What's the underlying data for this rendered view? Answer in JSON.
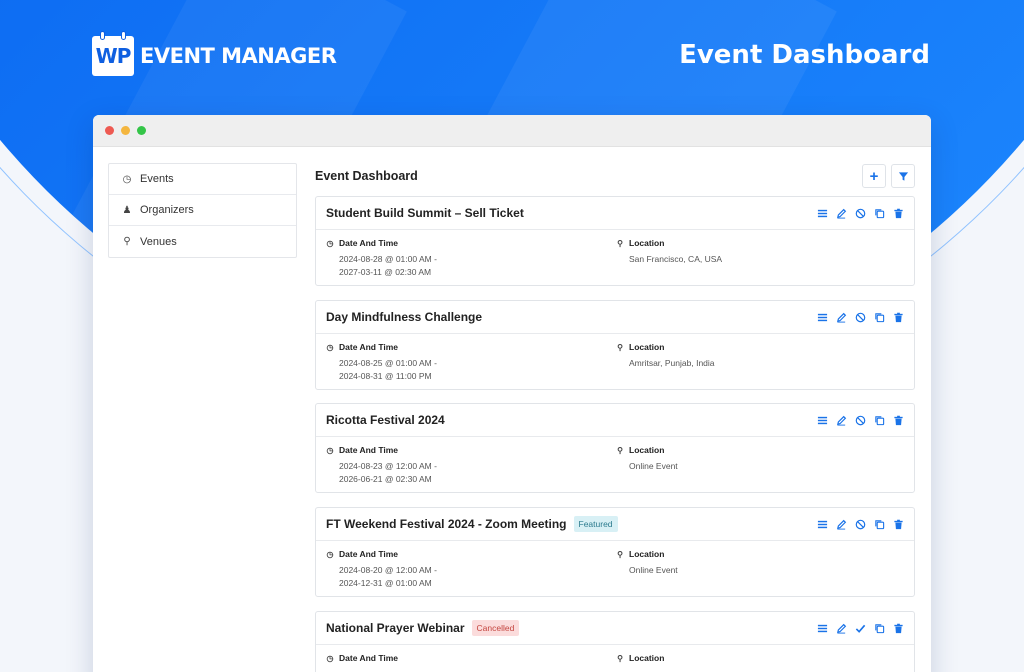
{
  "brand": {
    "mark": "WP",
    "name": "EVENT MANAGER"
  },
  "hero_title": "Event Dashboard",
  "sidebar": {
    "items": [
      {
        "label": "Events",
        "icon": "dashboard-icon"
      },
      {
        "label": "Organizers",
        "icon": "user-icon"
      },
      {
        "label": "Venues",
        "icon": "map-pin-icon"
      }
    ]
  },
  "main": {
    "title": "Event Dashboard",
    "buttons": {
      "add": "+",
      "filter": "filter-icon"
    }
  },
  "events": [
    {
      "title": "Student Build Summit – Sell Ticket",
      "badge": "",
      "date_label": "Date And Time",
      "date_start": "2024-08-28 @ 01:00 AM -",
      "date_end": "2027-03-11 @ 02:30 AM",
      "location_label": "Location",
      "location": "San Francisco, CA, USA",
      "status_action": "cancel-icon"
    },
    {
      "title": "Day Mindfulness Challenge",
      "badge": "",
      "date_label": "Date And Time",
      "date_start": "2024-08-25 @ 01:00 AM -",
      "date_end": "2024-08-31 @ 11:00 PM",
      "location_label": "Location",
      "location": "Amritsar, Punjab, India",
      "status_action": "cancel-icon"
    },
    {
      "title": "Ricotta Festival 2024",
      "badge": "",
      "date_label": "Date And Time",
      "date_start": "2024-08-23 @ 12:00 AM -",
      "date_end": "2026-06-21 @ 02:30 AM",
      "location_label": "Location",
      "location": "Online Event",
      "status_action": "cancel-icon"
    },
    {
      "title": "FT Weekend Festival 2024 - Zoom Meeting",
      "badge": "Featured",
      "date_label": "Date And Time",
      "date_start": "2024-08-20 @ 12:00 AM -",
      "date_end": "2024-12-31 @ 01:00 AM",
      "location_label": "Location",
      "location": "Online Event",
      "status_action": "cancel-icon"
    },
    {
      "title": "National Prayer Webinar",
      "badge": "Cancelled",
      "date_label": "Date And Time",
      "date_start": "",
      "date_end": "",
      "location_label": "Location",
      "location": "",
      "status_action": "check-icon"
    }
  ],
  "colors": {
    "accent": "#1a73e8",
    "hero": "#0d6cf2",
    "featured_bg": "#d8f0f5",
    "cancelled_bg": "#fbdcdc"
  }
}
